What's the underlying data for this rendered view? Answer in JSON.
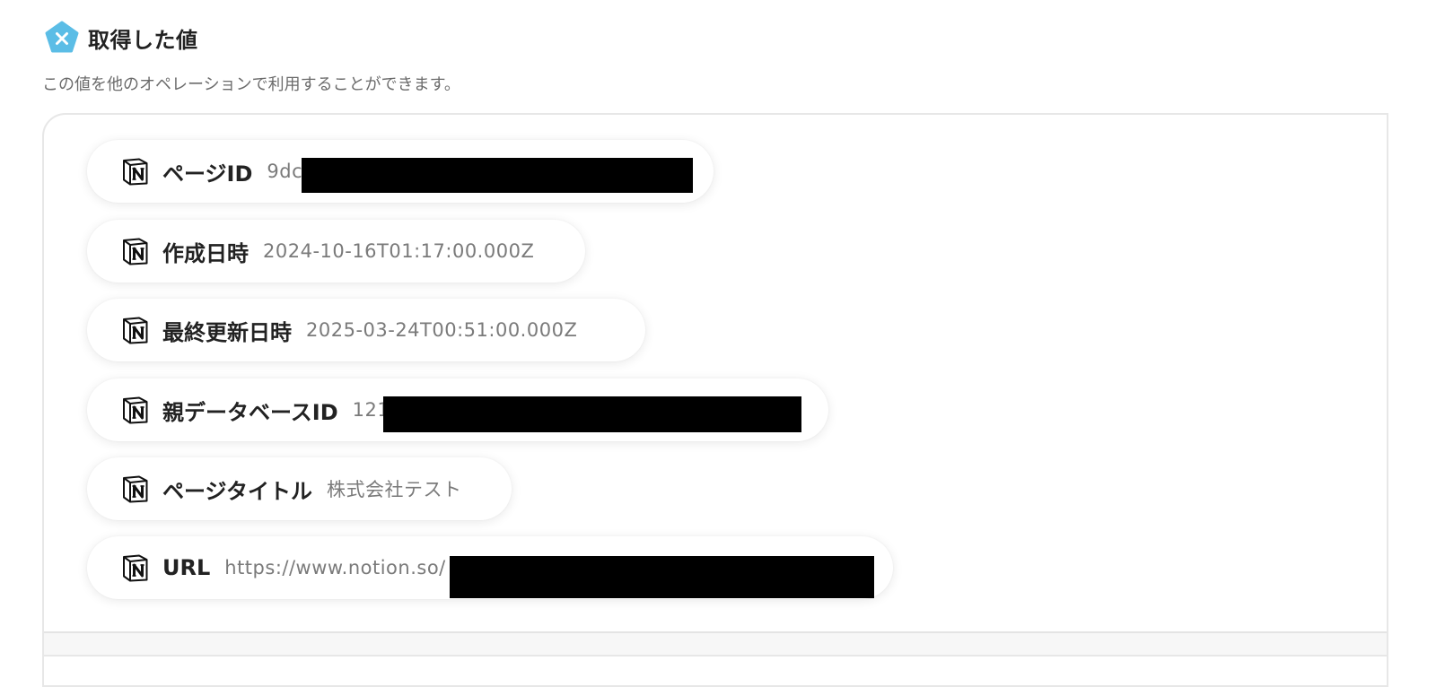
{
  "header": {
    "title": "取得した値",
    "subtitle": "この値を他のオペレーションで利用することができます。",
    "icon": "pentagon-x-icon",
    "icon_color": "#5bbde6"
  },
  "items": [
    {
      "label": "ページID",
      "value": "9dc",
      "icon": "notion-icon",
      "redacted": true
    },
    {
      "label": "作成日時",
      "value": "2024-10-16T01:17:00.000Z",
      "icon": "notion-icon",
      "redacted": false
    },
    {
      "label": "最終更新日時",
      "value": "2025-03-24T00:51:00.000Z",
      "icon": "notion-icon",
      "redacted": false
    },
    {
      "label": "親データベースID",
      "value": "121",
      "icon": "notion-icon",
      "redacted": true
    },
    {
      "label": "ページタイトル",
      "value": "株式会社テスト",
      "icon": "notion-icon",
      "redacted": false
    },
    {
      "label": "URL",
      "value": "https://www.notion.so/",
      "icon": "notion-icon",
      "redacted": true
    }
  ]
}
